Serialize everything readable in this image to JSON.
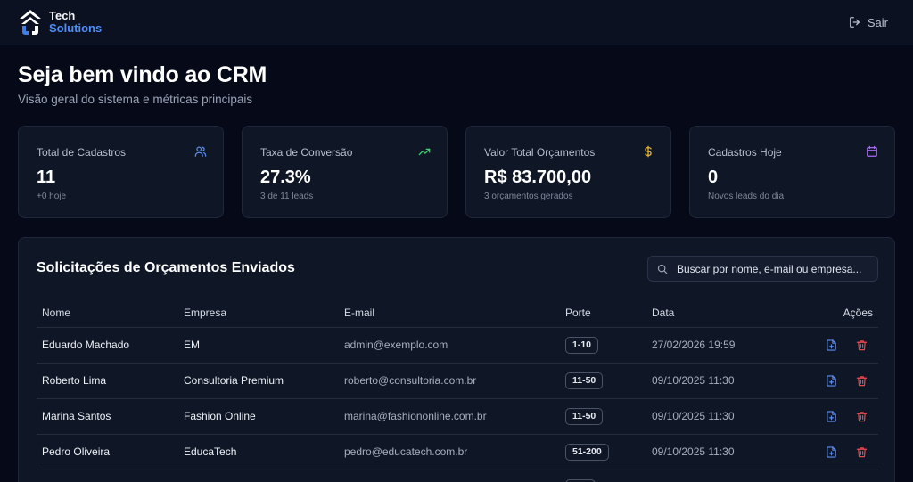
{
  "header": {
    "brand_line1": "Tech",
    "brand_line2": "Solutions",
    "logout_label": "Sair"
  },
  "page": {
    "title": "Seja bem vindo ao CRM",
    "subtitle": "Visão geral do sistema e métricas principais"
  },
  "stats": [
    {
      "label": "Total de Cadastros",
      "value": "11",
      "sub": "+0 hoje",
      "icon": "users-icon",
      "color": "#5b8def"
    },
    {
      "label": "Taxa de Conversão",
      "value": "27.3%",
      "sub": "3 de 11 leads",
      "icon": "trending-up-icon",
      "color": "#3fcf6e"
    },
    {
      "label": "Valor Total Orçamentos",
      "value": "R$ 83.700,00",
      "sub": "3 orçamentos gerados",
      "icon": "dollar-icon",
      "color": "#e0b43a"
    },
    {
      "label": "Cadastros Hoje",
      "value": "0",
      "sub": "Novos leads do dia",
      "icon": "calendar-icon",
      "color": "#a86bf5"
    }
  ],
  "quotes": {
    "title": "Solicitações de Orçamentos Enviados",
    "search_placeholder": "Buscar por nome, e-mail ou empresa...",
    "columns": [
      "Nome",
      "Empresa",
      "E-mail",
      "Porte",
      "Data",
      "Ações"
    ],
    "rows": [
      {
        "name": "Eduardo Machado",
        "company": "EM",
        "email": "admin@exemplo.com",
        "size": "1-10",
        "date": "27/02/2026 19:59"
      },
      {
        "name": "Roberto Lima",
        "company": "Consultoria Premium",
        "email": "roberto@consultoria.com.br",
        "size": "11-50",
        "date": "09/10/2025 11:30"
      },
      {
        "name": "Marina Santos",
        "company": "Fashion Online",
        "email": "marina@fashiononline.com.br",
        "size": "11-50",
        "date": "09/10/2025 11:30"
      },
      {
        "name": "Pedro Oliveira",
        "company": "EducaTech",
        "email": "pedro@educatech.com.br",
        "size": "51-200",
        "date": "09/10/2025 11:30"
      },
      {
        "name": "",
        "company": "",
        "email": "",
        "size": "",
        "date": ""
      }
    ]
  },
  "colors": {
    "accent": "#4f8df7",
    "danger": "#e5484d",
    "file_action": "#5b8def"
  }
}
